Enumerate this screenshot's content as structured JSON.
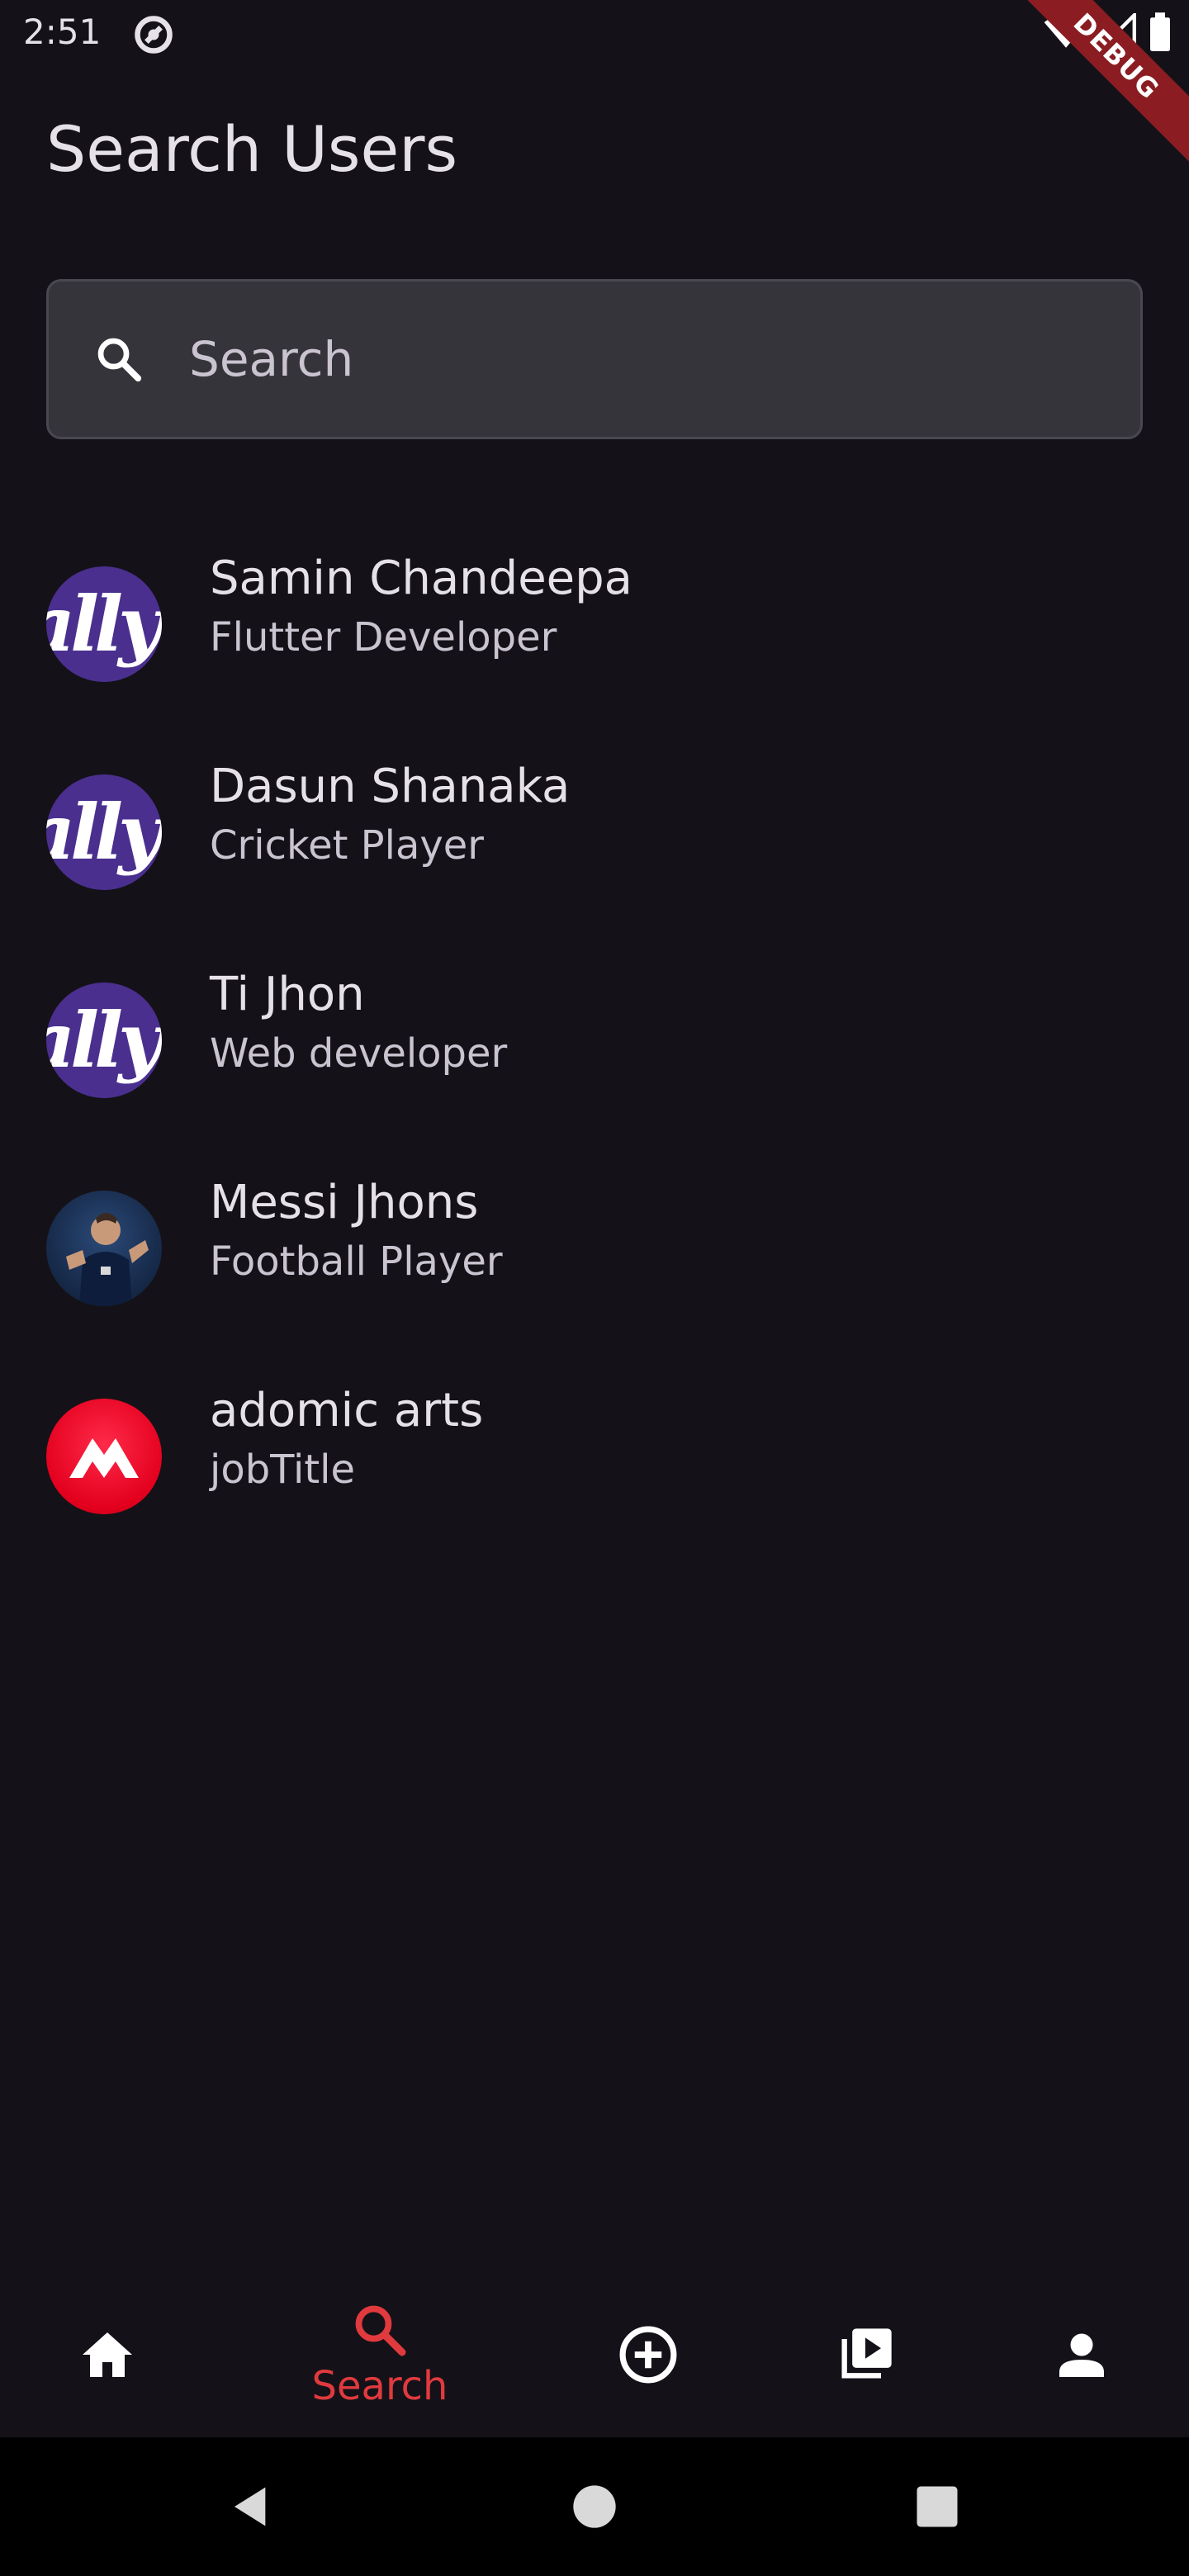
{
  "status_bar": {
    "time": "2:51",
    "debug_label": "DEBUG"
  },
  "page": {
    "title": "Search Users"
  },
  "search": {
    "placeholder": "Search",
    "value": ""
  },
  "users": [
    {
      "name": "Samin Chandeepa",
      "role": "Flutter Developer",
      "avatar": "ally",
      "avatar_text": "ally"
    },
    {
      "name": "Dasun Shanaka",
      "role": "Cricket Player",
      "avatar": "ally",
      "avatar_text": "ally"
    },
    {
      "name": "Ti Jhon",
      "role": "Web developer",
      "avatar": "ally",
      "avatar_text": "ally"
    },
    {
      "name": "Messi Jhons",
      "role": "Football Player",
      "avatar": "photo",
      "avatar_text": ""
    },
    {
      "name": "adomic arts",
      "role": "jobTitle",
      "avatar": "logo",
      "avatar_text": ""
    }
  ],
  "bottom_nav": {
    "items": [
      {
        "id": "home",
        "icon": "home-icon",
        "label": ""
      },
      {
        "id": "search",
        "icon": "search-icon",
        "label": "Search",
        "active": true
      },
      {
        "id": "add",
        "icon": "add-circle-icon",
        "label": ""
      },
      {
        "id": "videos",
        "icon": "video-library-icon",
        "label": ""
      },
      {
        "id": "profile",
        "icon": "person-icon",
        "label": ""
      }
    ],
    "active_color": "#E03A3E",
    "inactive_color": "#FFFFFF"
  },
  "colors": {
    "background": "#141218",
    "search_fill": "#36343B",
    "accent": "#E03A3E"
  }
}
